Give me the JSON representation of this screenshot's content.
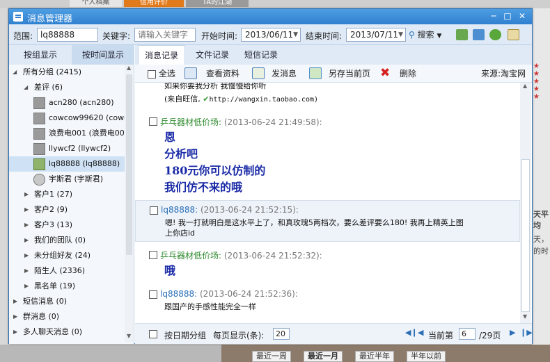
{
  "background": {
    "tabs": [
      "个人档案",
      "信用评价",
      "TA的江湖"
    ],
    "right_fragments": [
      "天平均",
      "天，",
      "的时"
    ],
    "period_buttons": [
      "最近一周",
      "最近一月",
      "最近半年",
      "半年以前"
    ]
  },
  "window": {
    "title": "消息管理器"
  },
  "filter": {
    "range_label": "范围:",
    "range_value": "lq88888",
    "keyword_label": "关键字:",
    "keyword_placeholder": "请输入关键字",
    "start_label": "开始时间:",
    "start_date": "2013/06/11",
    "end_label": "结束时间:",
    "end_date": "2013/07/11",
    "search_label": "搜索"
  },
  "left_tabs": [
    "按组显示",
    "按时间显示"
  ],
  "tree": {
    "all_groups": "所有分组 (2415)",
    "bad_reviews": "差评 (6)",
    "contacts": [
      "acn280 (acn280)",
      "cowcow99620 (cowcow",
      "浪费电001 (浪费电00",
      "llywcf2 (llywcf2)",
      "lq88888 (lq88888)",
      "宇斯君 (宇斯君)"
    ],
    "groups": [
      "客户1 (27)",
      "客户2 (9)",
      "客户3 (13)",
      "我们的团队 (0)",
      "未分组好友 (24)",
      "陌生人 (2336)",
      "黑名单 (19)"
    ],
    "top_level": [
      "短信消息 (0)",
      "群消息 (0)",
      "多人聊天消息 (0)"
    ]
  },
  "right_tabs": [
    "消息记录",
    "文件记录",
    "短信记录"
  ],
  "toolbar": {
    "select_all": "全选",
    "view_profile": "查看资料",
    "send_message": "发消息",
    "save_page": "另存当前页",
    "delete": "删除",
    "source": "来源:淘宝网"
  },
  "messages": {
    "partial_line1": "如果你要我分析 我慢慢给你听",
    "partial_line2": "(来自旺信, ",
    "partial_link": "http://wangxin.taobao.com)",
    "items": [
      {
        "name": "乒乓器材低价场:",
        "time": "(2013-06-24 21:49:58):",
        "lines": [
          "恩",
          "分析吧",
          "180元你可以仿制的",
          "我们仿不来的哦"
        ]
      },
      {
        "name": "lq88888:",
        "time": "(2013-06-24 21:52:15):",
        "lines": [
          "嗯! 我一打就明白是这水平上了，和真玫瑰5两档次，要么差评要么180! 我再上精英上图",
          "上你店id"
        ]
      },
      {
        "name": "乒乓器材低价场:",
        "time": "(2013-06-24 21:52:32):",
        "lines": [
          "哦"
        ]
      },
      {
        "name": "lq88888:",
        "time": "(2013-06-24 21:52:36):",
        "lines": [
          "跟国产的手感性能完全一样"
        ]
      }
    ]
  },
  "footer": {
    "group_by_date": "按日期分组",
    "per_page_label": "每页显示(条):",
    "per_page_value": "20",
    "current_label": "当前第",
    "current_page": "6",
    "total_pages": "/29页"
  },
  "colors": {
    "accent": "#2f80d0",
    "seller_name": "#2d8a2d",
    "buyer_name": "#2a6fb6",
    "big_text": "#1a2aa6"
  }
}
